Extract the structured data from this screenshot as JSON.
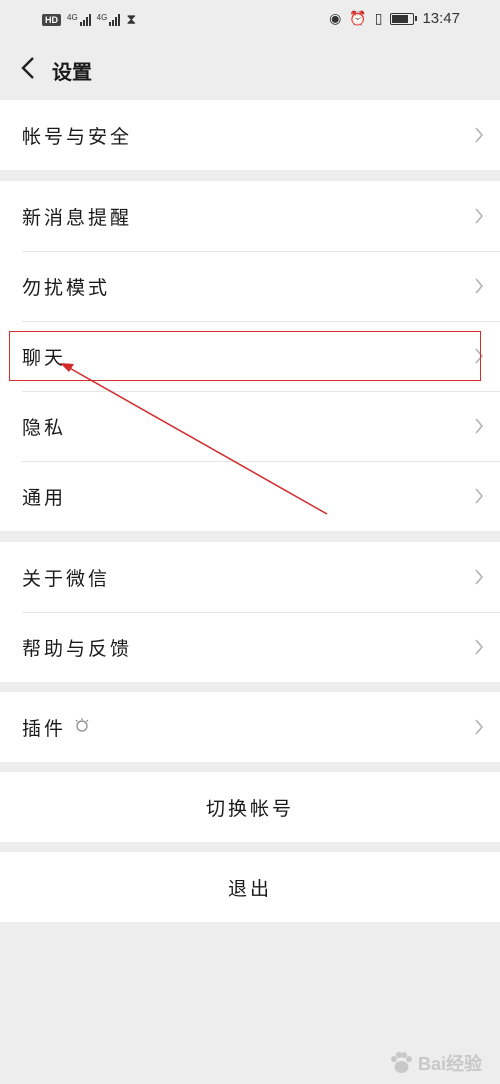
{
  "status_bar": {
    "hd": "HD",
    "net1": "4G",
    "net2": "4G",
    "time": "13:47",
    "icons": [
      "eye-icon",
      "alarm-icon",
      "vibrate-icon",
      "battery-icon"
    ],
    "battery_level": 0.85
  },
  "nav": {
    "title": "设置",
    "back_icon": "chevron-left-icon"
  },
  "groups": {
    "account": {
      "items": [
        "帐号与安全"
      ]
    },
    "notify": {
      "items": [
        "新消息提醒",
        "勿扰模式",
        "聊天",
        "隐私",
        "通用"
      ]
    },
    "about": {
      "items": [
        "关于微信",
        "帮助与反馈"
      ]
    },
    "plugins": {
      "items": [
        "插件"
      ],
      "plugin_badge_icon": "plugin-bulb-icon"
    },
    "switch_account": {
      "label": "切换帐号"
    },
    "logout": {
      "label": "退出"
    }
  },
  "annotation": {
    "highlight_color": "#d12b2b"
  },
  "watermark": {
    "text": "Bai经验"
  }
}
